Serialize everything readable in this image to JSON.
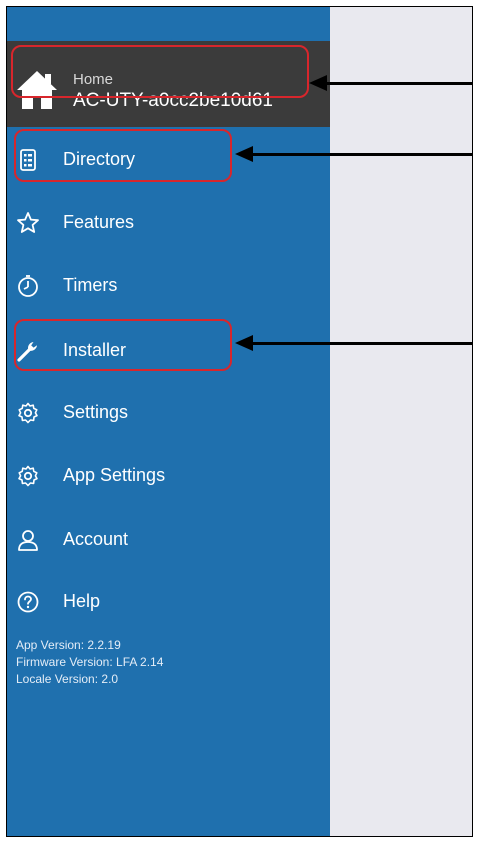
{
  "home": {
    "label": "Home",
    "device_name": "AC-UTY-a0cc2be10d61"
  },
  "menu": [
    {
      "label": "Directory",
      "icon": "directory-icon"
    },
    {
      "label": "Features",
      "icon": "star-icon"
    },
    {
      "label": "Timers",
      "icon": "timer-icon"
    },
    {
      "label": "Installer",
      "icon": "wrench-icon"
    },
    {
      "label": "Settings",
      "icon": "gear-icon"
    },
    {
      "label": "App Settings",
      "icon": "gear-icon"
    },
    {
      "label": "Account",
      "icon": "user-icon"
    },
    {
      "label": "Help",
      "icon": "help-icon"
    }
  ],
  "versions": {
    "app": "App Version: 2.2.19",
    "firmware": "Firmware Version: LFA 2.14",
    "locale": "Locale Version: 2.0"
  },
  "colors": {
    "sidebar": "#1f70ae",
    "home_bar": "#3b3b3b",
    "highlight": "#d8262c",
    "content_bg": "#e9e9ef"
  }
}
